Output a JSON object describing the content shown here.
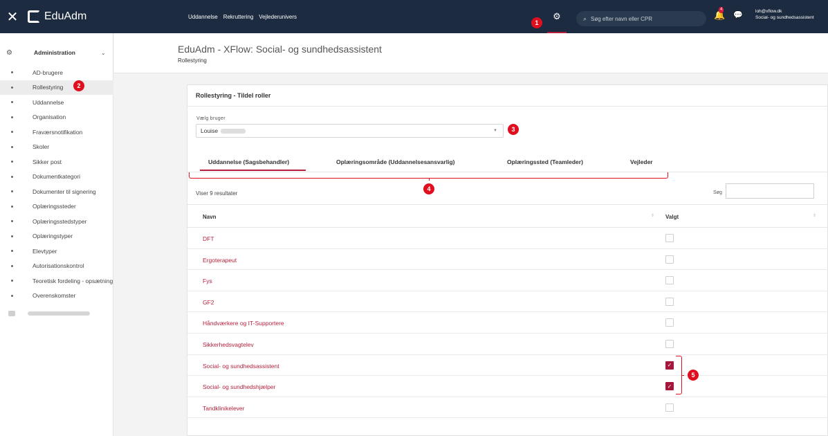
{
  "topbar": {
    "close_icon": "close-icon",
    "app_name": "EduAdm",
    "nav": [
      "Uddannelse",
      "Rekruttering",
      "Vejlederunivers"
    ],
    "search_placeholder": "Søg efter navn eller CPR",
    "notification_count": "4",
    "user_email": "loh@xflow.dk",
    "user_role": "Social- og sundhedsassistent"
  },
  "sidebar": {
    "section": "Administration",
    "items": [
      "AD-brugere",
      "Rollestyring",
      "Uddannelse",
      "Organisation",
      "Fraværsnotifikation",
      "Skoler",
      "Sikker post",
      "Dokumentkategori",
      "Dokumenter til signering",
      "Oplæringssteder",
      "Oplæringsstedstyper",
      "Oplæringstyper",
      "Elevtyper",
      "Autorisationskontrol",
      "Teoretisk fordeling - opsætning",
      "Overenskomster"
    ],
    "active_index": 1
  },
  "header": {
    "title": "EduAdm - XFlow: Social- og sundhedsassistent",
    "subtitle": "Rollestyring"
  },
  "card": {
    "title": "Rollestyring - Tildel roller",
    "user_label": "Vælg bruger",
    "user_value": "Louise"
  },
  "tabs": [
    "Uddannelse (Sagsbehandler)",
    "Oplæringsområde (Uddannelsesansvarlig)",
    "Oplæringssted (Teamleder)",
    "Vejleder"
  ],
  "table": {
    "results_text": "Viser 9 resultater",
    "search_label": "Søg",
    "col_name": "Navn",
    "col_selected": "Valgt",
    "rows": [
      {
        "name": "DFT",
        "checked": false
      },
      {
        "name": "Ergoterapeut",
        "checked": false
      },
      {
        "name": "Fys",
        "checked": false
      },
      {
        "name": "GF2",
        "checked": false
      },
      {
        "name": "Håndværkere og IT-Supportere",
        "checked": false
      },
      {
        "name": "Sikkerhedsvagtelev",
        "checked": false
      },
      {
        "name": "Social- og sundhedsassistent",
        "checked": true
      },
      {
        "name": "Social- og sundhedshjælper",
        "checked": true
      },
      {
        "name": "Tandklinikelever",
        "checked": false
      }
    ]
  },
  "annotations": [
    "1",
    "2",
    "3",
    "4",
    "5"
  ],
  "colors": {
    "topbar": "#1c2b3f",
    "accent": "#b51f3b",
    "annotation": "#e00f1f"
  }
}
